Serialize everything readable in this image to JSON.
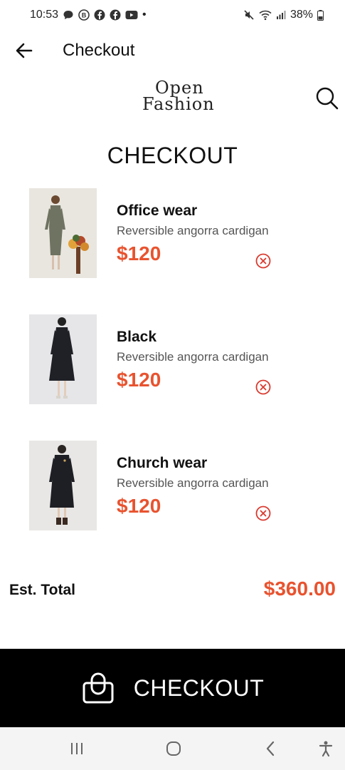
{
  "status_bar": {
    "time": "10:53",
    "battery": "38%"
  },
  "app_bar": {
    "title": "Checkout"
  },
  "brand": {
    "line1": "Open",
    "line2": "Fashion"
  },
  "page": {
    "heading": "CHECKOUT"
  },
  "items": [
    {
      "name": "Office wear",
      "description": "Reversible angorra cardigan",
      "price": "$120"
    },
    {
      "name": "Black",
      "description": "Reversible angorra cardigan",
      "price": "$120"
    },
    {
      "name": "Church wear",
      "description": "Reversible angorra cardigan",
      "price": "$120"
    }
  ],
  "total": {
    "label": "Est. Total",
    "value": "$360.00"
  },
  "checkout_button": {
    "label": "CHECKOUT"
  },
  "colors": {
    "accent": "#e8532f",
    "button_bg": "#000000"
  }
}
